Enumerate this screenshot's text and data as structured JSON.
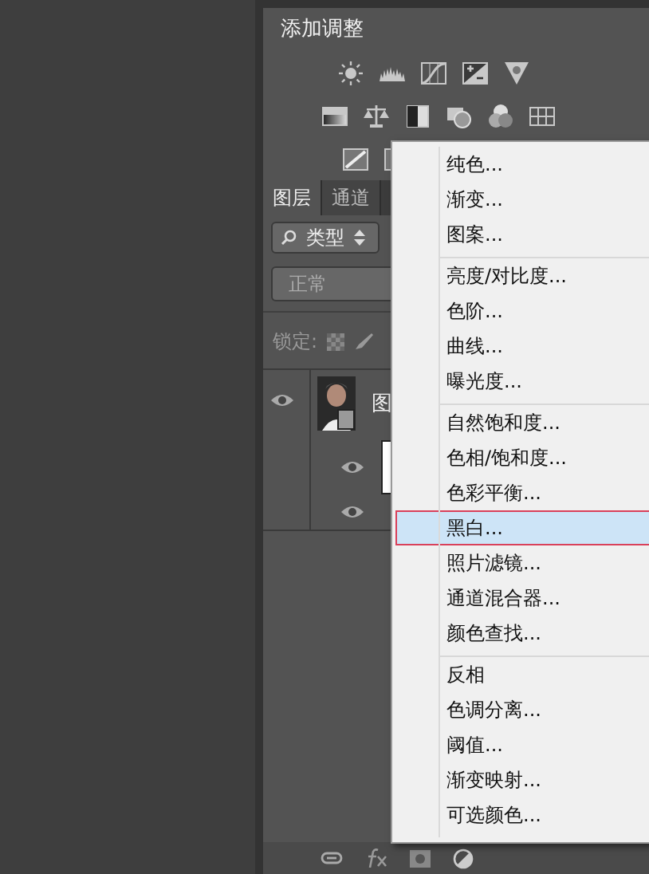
{
  "adjustments_panel": {
    "title": "添加调整"
  },
  "layers_panel": {
    "tabs": [
      {
        "label": "图层",
        "selected": true
      },
      {
        "label": "通道",
        "selected": false
      }
    ],
    "filter": {
      "value": "类型"
    },
    "blend_mode": {
      "value": "正常"
    },
    "lock_label": "锁定:",
    "layers": [
      {
        "name": "图"
      }
    ]
  },
  "context_menu": {
    "groups": [
      {
        "items": [
          {
            "label": "纯色...",
            "selected": false
          },
          {
            "label": "渐变...",
            "selected": false
          },
          {
            "label": "图案...",
            "selected": false
          }
        ]
      },
      {
        "items": [
          {
            "label": "亮度/对比度...",
            "selected": false
          },
          {
            "label": "色阶...",
            "selected": false
          },
          {
            "label": "曲线...",
            "selected": false
          },
          {
            "label": "曝光度...",
            "selected": false
          }
        ]
      },
      {
        "items": [
          {
            "label": "自然饱和度...",
            "selected": false
          },
          {
            "label": "色相/饱和度...",
            "selected": false
          },
          {
            "label": "色彩平衡...",
            "selected": false
          },
          {
            "label": "黑白...",
            "selected": true
          },
          {
            "label": "照片滤镜...",
            "selected": false
          },
          {
            "label": "通道混合器...",
            "selected": false
          },
          {
            "label": "颜色查找...",
            "selected": false
          }
        ]
      },
      {
        "items": [
          {
            "label": "反相",
            "selected": false
          },
          {
            "label": "色调分离...",
            "selected": false
          },
          {
            "label": "阈值...",
            "selected": false
          },
          {
            "label": "渐变映射...",
            "selected": false
          },
          {
            "label": "可选颜色...",
            "selected": false
          }
        ]
      }
    ]
  }
}
